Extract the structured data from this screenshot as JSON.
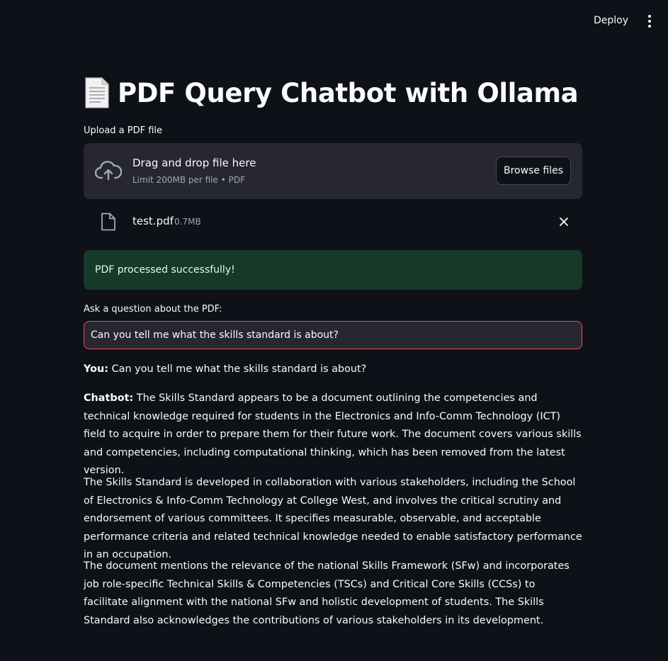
{
  "header": {
    "deploy_label": "Deploy"
  },
  "page": {
    "title_emoji": "page-facing-up-icon",
    "title": "PDF Query Chatbot with Ollama"
  },
  "uploader": {
    "label": "Upload a PDF file",
    "drag_text": "Drag and drop file here",
    "limit_text": "Limit 200MB per file • PDF",
    "browse_label": "Browse files",
    "file": {
      "name": "test.pdf",
      "size": "0.7MB"
    }
  },
  "status": {
    "message": "PDF processed successfully!",
    "color": "#173928"
  },
  "question": {
    "label": "Ask a question about the PDF:",
    "value": "Can you tell me what the skills standard is about?"
  },
  "chat": {
    "user_label": "You:",
    "user_message": "Can you tell me what the skills standard is about?",
    "bot_label": "Chatbot:",
    "bot_para1": "The Skills Standard appears to be a document outlining the competencies and technical knowledge required for students in the Electronics and Info-Comm Technology (ICT) field to acquire in order to prepare them for their future work. The document covers various skills and competencies, including computational thinking, which has been removed from the latest version.",
    "bot_para2": "The Skills Standard is developed in collaboration with various stakeholders, including the School of Electronics & Info-Comm Technology at College West, and involves the critical scrutiny and endorsement of various committees. It specifies measurable, observable, and acceptable performance criteria and related technical knowledge needed to enable satisfactory performance in an occupation.",
    "bot_para3": "The document mentions the relevance of the national Skills Framework (SFw) and incorporates job role-specific Technical Skills & Competencies (TSCs) and Critical Core Skills (CCSs) to facilitate alignment with the national SFw and holistic development of students. The Skills Standard also acknowledges the contributions of various stakeholders in its development."
  },
  "colors": {
    "background": "#0e1117",
    "accent": "#ff4b4b",
    "panel": "#262730"
  }
}
